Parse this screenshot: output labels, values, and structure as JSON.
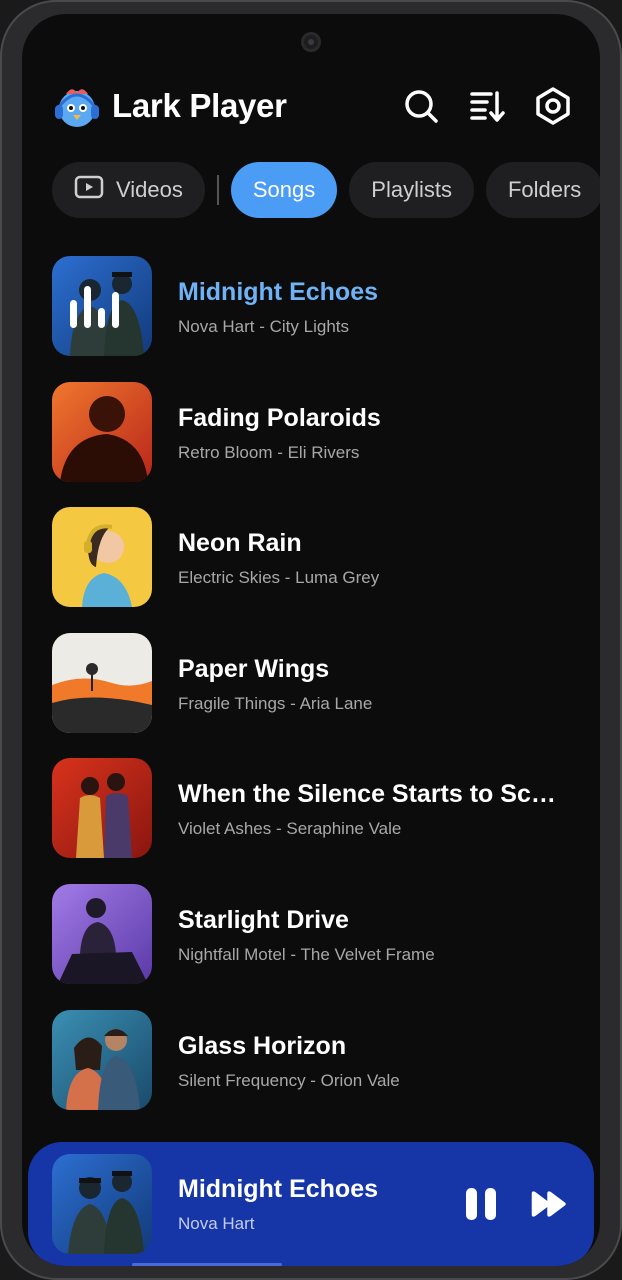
{
  "app": {
    "title": "Lark Player"
  },
  "header": {
    "icons": [
      "search-icon",
      "sort-icon",
      "settings-icon"
    ]
  },
  "tabs": [
    {
      "label": "Videos",
      "icon": "video-icon",
      "active": false
    },
    {
      "label": "Songs",
      "active": true
    },
    {
      "label": "Playlists",
      "active": false
    },
    {
      "label": "Folders",
      "active": false
    }
  ],
  "songs": [
    {
      "title": "Midnight Echoes",
      "subtitle": "Nova Hart - City Lights",
      "playing": true
    },
    {
      "title": "Fading Polaroids",
      "subtitle": "Retro Bloom - Eli Rivers"
    },
    {
      "title": "Neon Rain",
      "subtitle": "Electric Skies - Luma Grey"
    },
    {
      "title": "Paper Wings",
      "subtitle": "Fragile Things - Aria Lane"
    },
    {
      "title": "When the Silence Starts to Sc…",
      "subtitle": "Violet Ashes - Seraphine Vale"
    },
    {
      "title": "Starlight Drive",
      "subtitle": "Nightfall Motel - The Velvet Frame"
    },
    {
      "title": "Glass Horizon",
      "subtitle": "Silent Frequency - Orion Vale"
    }
  ],
  "now_playing": {
    "title": "Midnight Echoes",
    "artist": "Nova Hart",
    "state": "playing"
  },
  "colors": {
    "accent": "#4a9cf4",
    "player_bg": "#1636a8",
    "background": "#0c0c0c"
  }
}
